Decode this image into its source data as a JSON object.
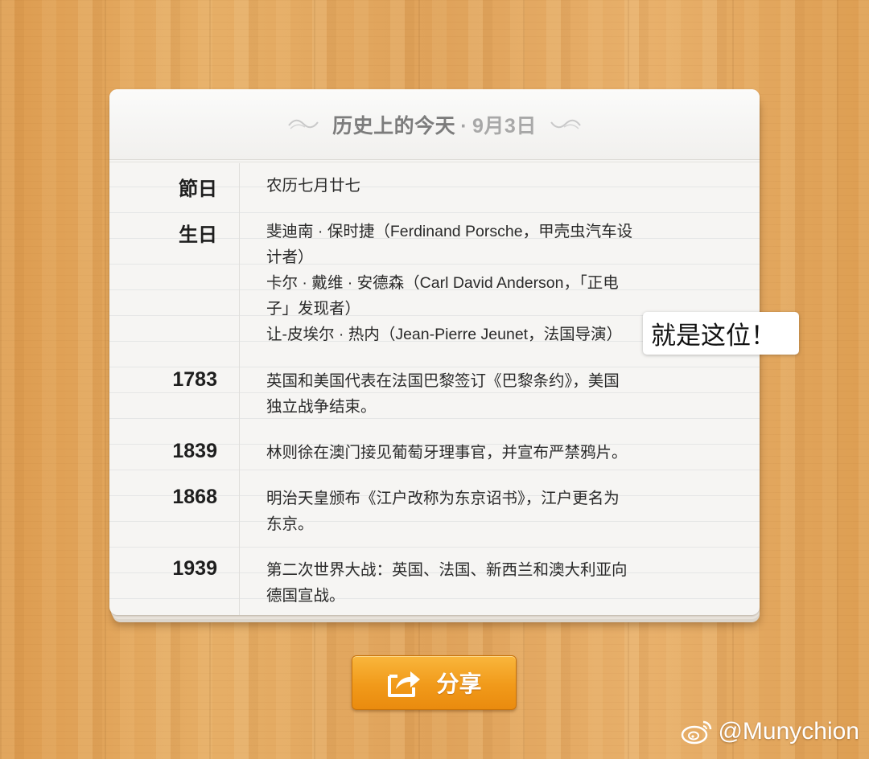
{
  "header": {
    "title": "历史上的今天",
    "separator": "·",
    "date": "9月3日"
  },
  "rows": [
    {
      "label": "節日",
      "lines": [
        "农历七月廿七"
      ]
    },
    {
      "label": "生日",
      "lines": [
        "斐迪南 · 保时捷（Ferdinand Porsche，甲壳虫汽车设",
        "计者）",
        "卡尔 · 戴维 · 安德森（Carl David Anderson，「正电",
        "子」发现者）",
        "让-皮埃尔 · 热内（Jean-Pierre Jeunet，法国导演）"
      ]
    },
    {
      "label": "1783",
      "lines": [
        "英国和美国代表在法国巴黎签订《巴黎条约》，美国",
        "独立战争结束。"
      ]
    },
    {
      "label": "1839",
      "lines": [
        "林则徐在澳门接见葡萄牙理事官，并宣布严禁鸦片。"
      ]
    },
    {
      "label": "1868",
      "lines": [
        "明治天皇颁布《江户改称为东京诏书》，江户更名为",
        "东京。"
      ]
    },
    {
      "label": "1939",
      "lines": [
        "第二次世界大战：英国、法国、新西兰和澳大利亚向",
        "德国宣战。"
      ]
    }
  ],
  "annotation": {
    "text": "就是这位！"
  },
  "share_button": {
    "label": "分享",
    "icon": "share-icon"
  },
  "watermark": {
    "text": "@Munychion",
    "icon": "weibo-icon"
  },
  "colors": {
    "button_orange": "#f19a1a",
    "title_gray": "#7c7c7c",
    "wood": "#e2a55a"
  }
}
